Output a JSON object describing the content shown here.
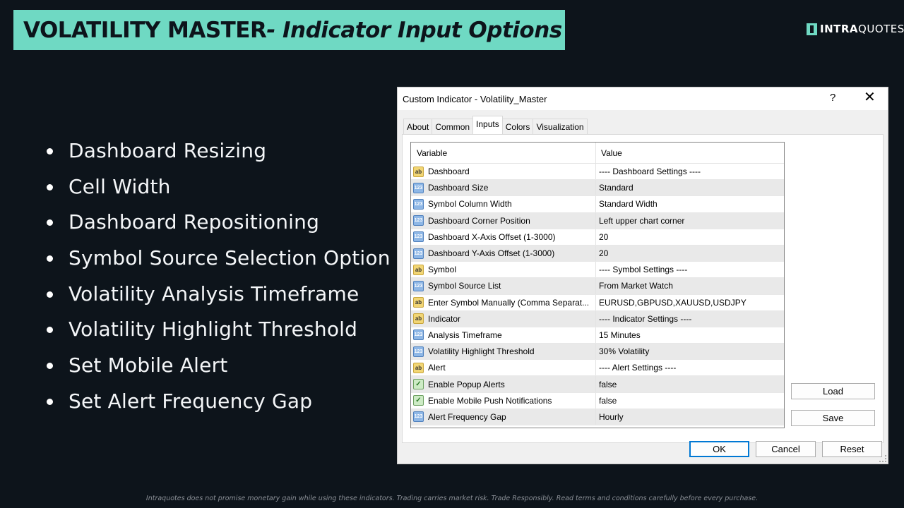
{
  "header": {
    "title_bold": "VOLATILITY MASTER",
    "title_italic": "- Indicator Input Options"
  },
  "logo": {
    "part1": "INTRA",
    "part2": "QUOTES"
  },
  "bullets": [
    "Dashboard Resizing",
    "Cell Width",
    "Dashboard Repositioning",
    "Symbol Source Selection Option",
    "Volatility Analysis Timeframe",
    "Volatility Highlight Threshold",
    "Set Mobile Alert",
    "Set Alert Frequency Gap"
  ],
  "dialog": {
    "title": "Custom Indicator - Volatility_Master",
    "help": "?",
    "close": "✕",
    "tabs": [
      "About",
      "Common",
      "Inputs",
      "Colors",
      "Visualization"
    ],
    "active_tab": "Inputs",
    "columns": {
      "variable": "Variable",
      "value": "Value"
    },
    "rows": [
      {
        "icon": "ab",
        "variable": "Dashboard",
        "value": "---- Dashboard Settings ----"
      },
      {
        "icon": "123",
        "variable": "Dashboard Size",
        "value": "Standard"
      },
      {
        "icon": "123",
        "variable": "Symbol Column Width",
        "value": "Standard Width"
      },
      {
        "icon": "123",
        "variable": "Dashboard Corner Position",
        "value": "Left upper chart corner"
      },
      {
        "icon": "123",
        "variable": "Dashboard X-Axis Offset (1-3000)",
        "value": "20"
      },
      {
        "icon": "123",
        "variable": "Dashboard Y-Axis Offset (1-3000)",
        "value": "20"
      },
      {
        "icon": "ab",
        "variable": "Symbol",
        "value": "---- Symbol Settings ----"
      },
      {
        "icon": "123",
        "variable": "Symbol Source List",
        "value": "From Market Watch"
      },
      {
        "icon": "ab",
        "variable": "Enter Symbol Manually (Comma Separat...",
        "value": "EURUSD,GBPUSD,XAUUSD,USDJPY"
      },
      {
        "icon": "ab",
        "variable": "Indicator",
        "value": "---- Indicator Settings ----"
      },
      {
        "icon": "123",
        "variable": "Analysis Timeframe",
        "value": "15 Minutes"
      },
      {
        "icon": "123",
        "variable": "Volatility Highlight Threshold",
        "value": "30% Volatility"
      },
      {
        "icon": "ab",
        "variable": "Alert",
        "value": "---- Alert Settings ----"
      },
      {
        "icon": "bool",
        "variable": "Enable Popup Alerts",
        "value": "false"
      },
      {
        "icon": "bool",
        "variable": "Enable Mobile Push Notifications",
        "value": "false"
      },
      {
        "icon": "123",
        "variable": "Alert Frequency Gap",
        "value": "Hourly"
      }
    ],
    "buttons": {
      "load": "Load",
      "save": "Save",
      "ok": "OK",
      "cancel": "Cancel",
      "reset": "Reset"
    }
  },
  "disclaimer": "Intraquotes does not promise monetary gain while using these indicators. Trading carries market risk. Trade Responsibly. Read terms and conditions carefully before every purchase."
}
